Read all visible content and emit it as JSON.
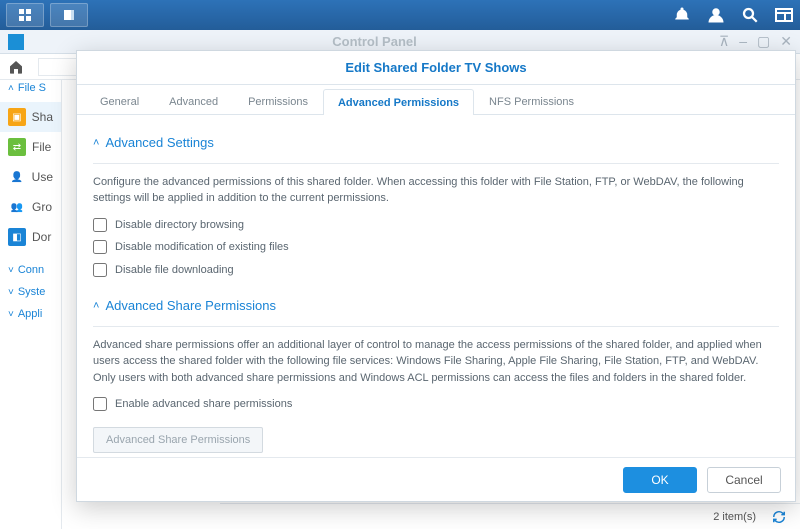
{
  "window": {
    "title": "Control Panel"
  },
  "sidebar": {
    "section_label": "File S",
    "items": [
      {
        "label": "Sha",
        "icon_bg": "#f7a516"
      },
      {
        "label": "File",
        "icon_bg": "#6bbf3e"
      },
      {
        "label": "Use",
        "icon_bg": "#e8b08a"
      },
      {
        "label": "Gro",
        "icon_bg": "#e8b08a"
      },
      {
        "label": "Dor",
        "icon_bg": "#1a84d6"
      }
    ],
    "collapsed": [
      {
        "label": "Conn"
      },
      {
        "label": "Syste"
      },
      {
        "label": "Appli"
      }
    ]
  },
  "status": {
    "count_text": "2 item(s)"
  },
  "dialog": {
    "title": "Edit Shared Folder TV Shows",
    "tabs": [
      "General",
      "Advanced",
      "Permissions",
      "Advanced Permissions",
      "NFS Permissions"
    ],
    "active_tab": "Advanced Permissions",
    "section1": {
      "title": "Advanced Settings",
      "desc": "Configure the advanced permissions of this shared folder. When accessing this folder with File Station, FTP, or WebDAV, the following settings will be applied in addition to the current permissions.",
      "checks": [
        "Disable directory browsing",
        "Disable modification of existing files",
        "Disable file downloading"
      ]
    },
    "section2": {
      "title": "Advanced Share Permissions",
      "desc": "Advanced share permissions offer an additional layer of control to manage the access permissions of the shared folder, and applied when users access the shared folder with the following file services: Windows File Sharing, Apple File Sharing, File Station, FTP, and WebDAV. Only users with both advanced share permissions and Windows ACL permissions can access the files and folders in the shared folder.",
      "check": "Enable advanced share permissions",
      "button": "Advanced Share Permissions"
    },
    "buttons": {
      "ok": "OK",
      "cancel": "Cancel"
    }
  }
}
